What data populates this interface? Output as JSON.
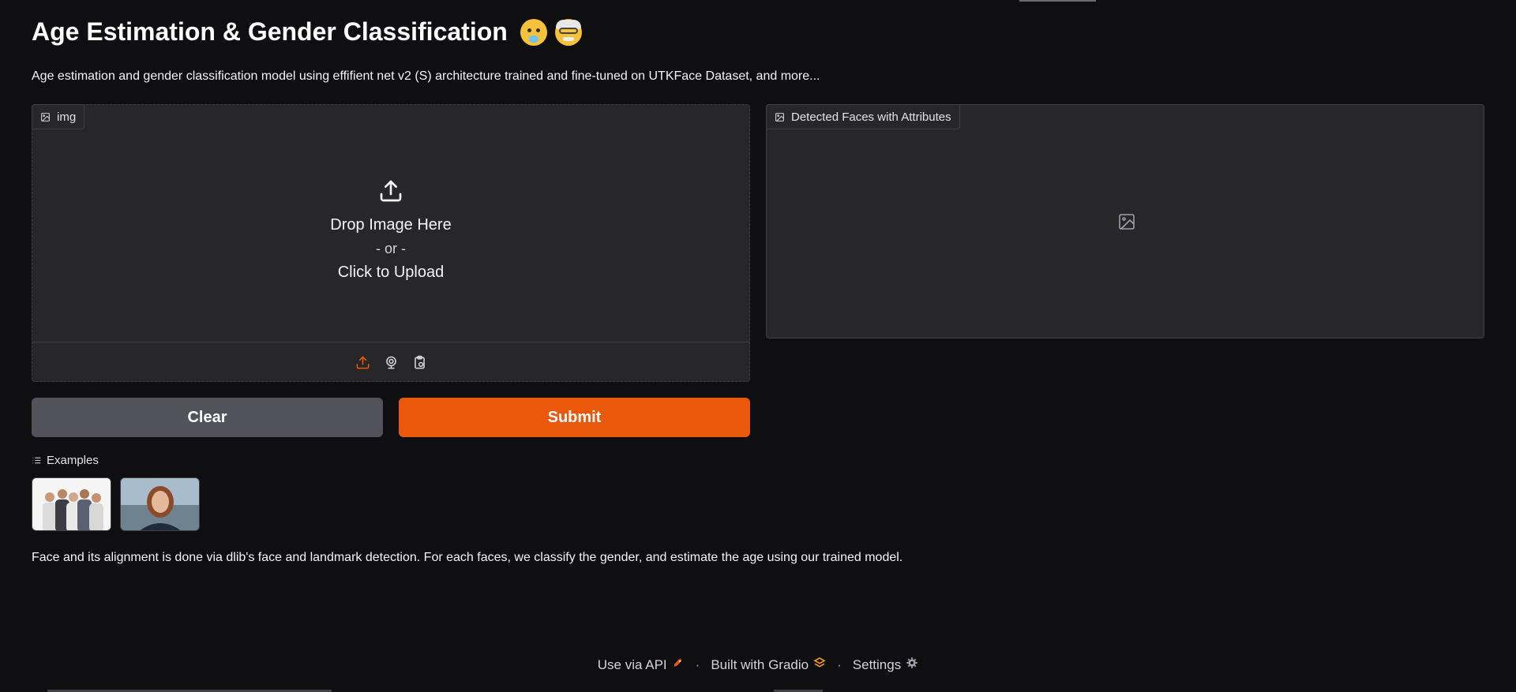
{
  "header": {
    "title": "Age Estimation & Gender Classification",
    "emoji_1": "baby-face-emoji",
    "emoji_2": "older-person-emoji",
    "description": "Age estimation and gender classification model using effifient net v2 (S) architecture trained and fine-tuned on UTKFace Dataset, and more..."
  },
  "input_panel": {
    "label": "img",
    "icon": "image-icon",
    "drop_text": "Drop Image Here",
    "or_text": "- or -",
    "click_text": "Click to Upload",
    "sources": [
      "upload-icon",
      "webcam-icon",
      "clipboard-icon"
    ],
    "active_source_color": "#ea580c"
  },
  "output_panel": {
    "label": "Detected Faces with Attributes",
    "icon": "image-icon",
    "empty_icon": "image-placeholder-icon"
  },
  "buttons": {
    "clear_label": "Clear",
    "submit_label": "Submit",
    "submit_color": "#ea580c",
    "clear_color": "#52525b"
  },
  "examples": {
    "label": "Examples",
    "icon": "list-icon",
    "items": [
      "group-photo-thumbnail",
      "woman-portrait-thumbnail"
    ]
  },
  "note": "Face and its alignment is done via dlib's face and landmark detection. For each faces, we classify the gender, and estimate the age using our trained model.",
  "footer": {
    "api_label": "Use via API",
    "built_label": "Built with Gradio",
    "settings_label": "Settings",
    "separator": "·"
  },
  "colors": {
    "background": "#0f0f11",
    "panel": "#27272a",
    "accent": "#ea580c"
  }
}
